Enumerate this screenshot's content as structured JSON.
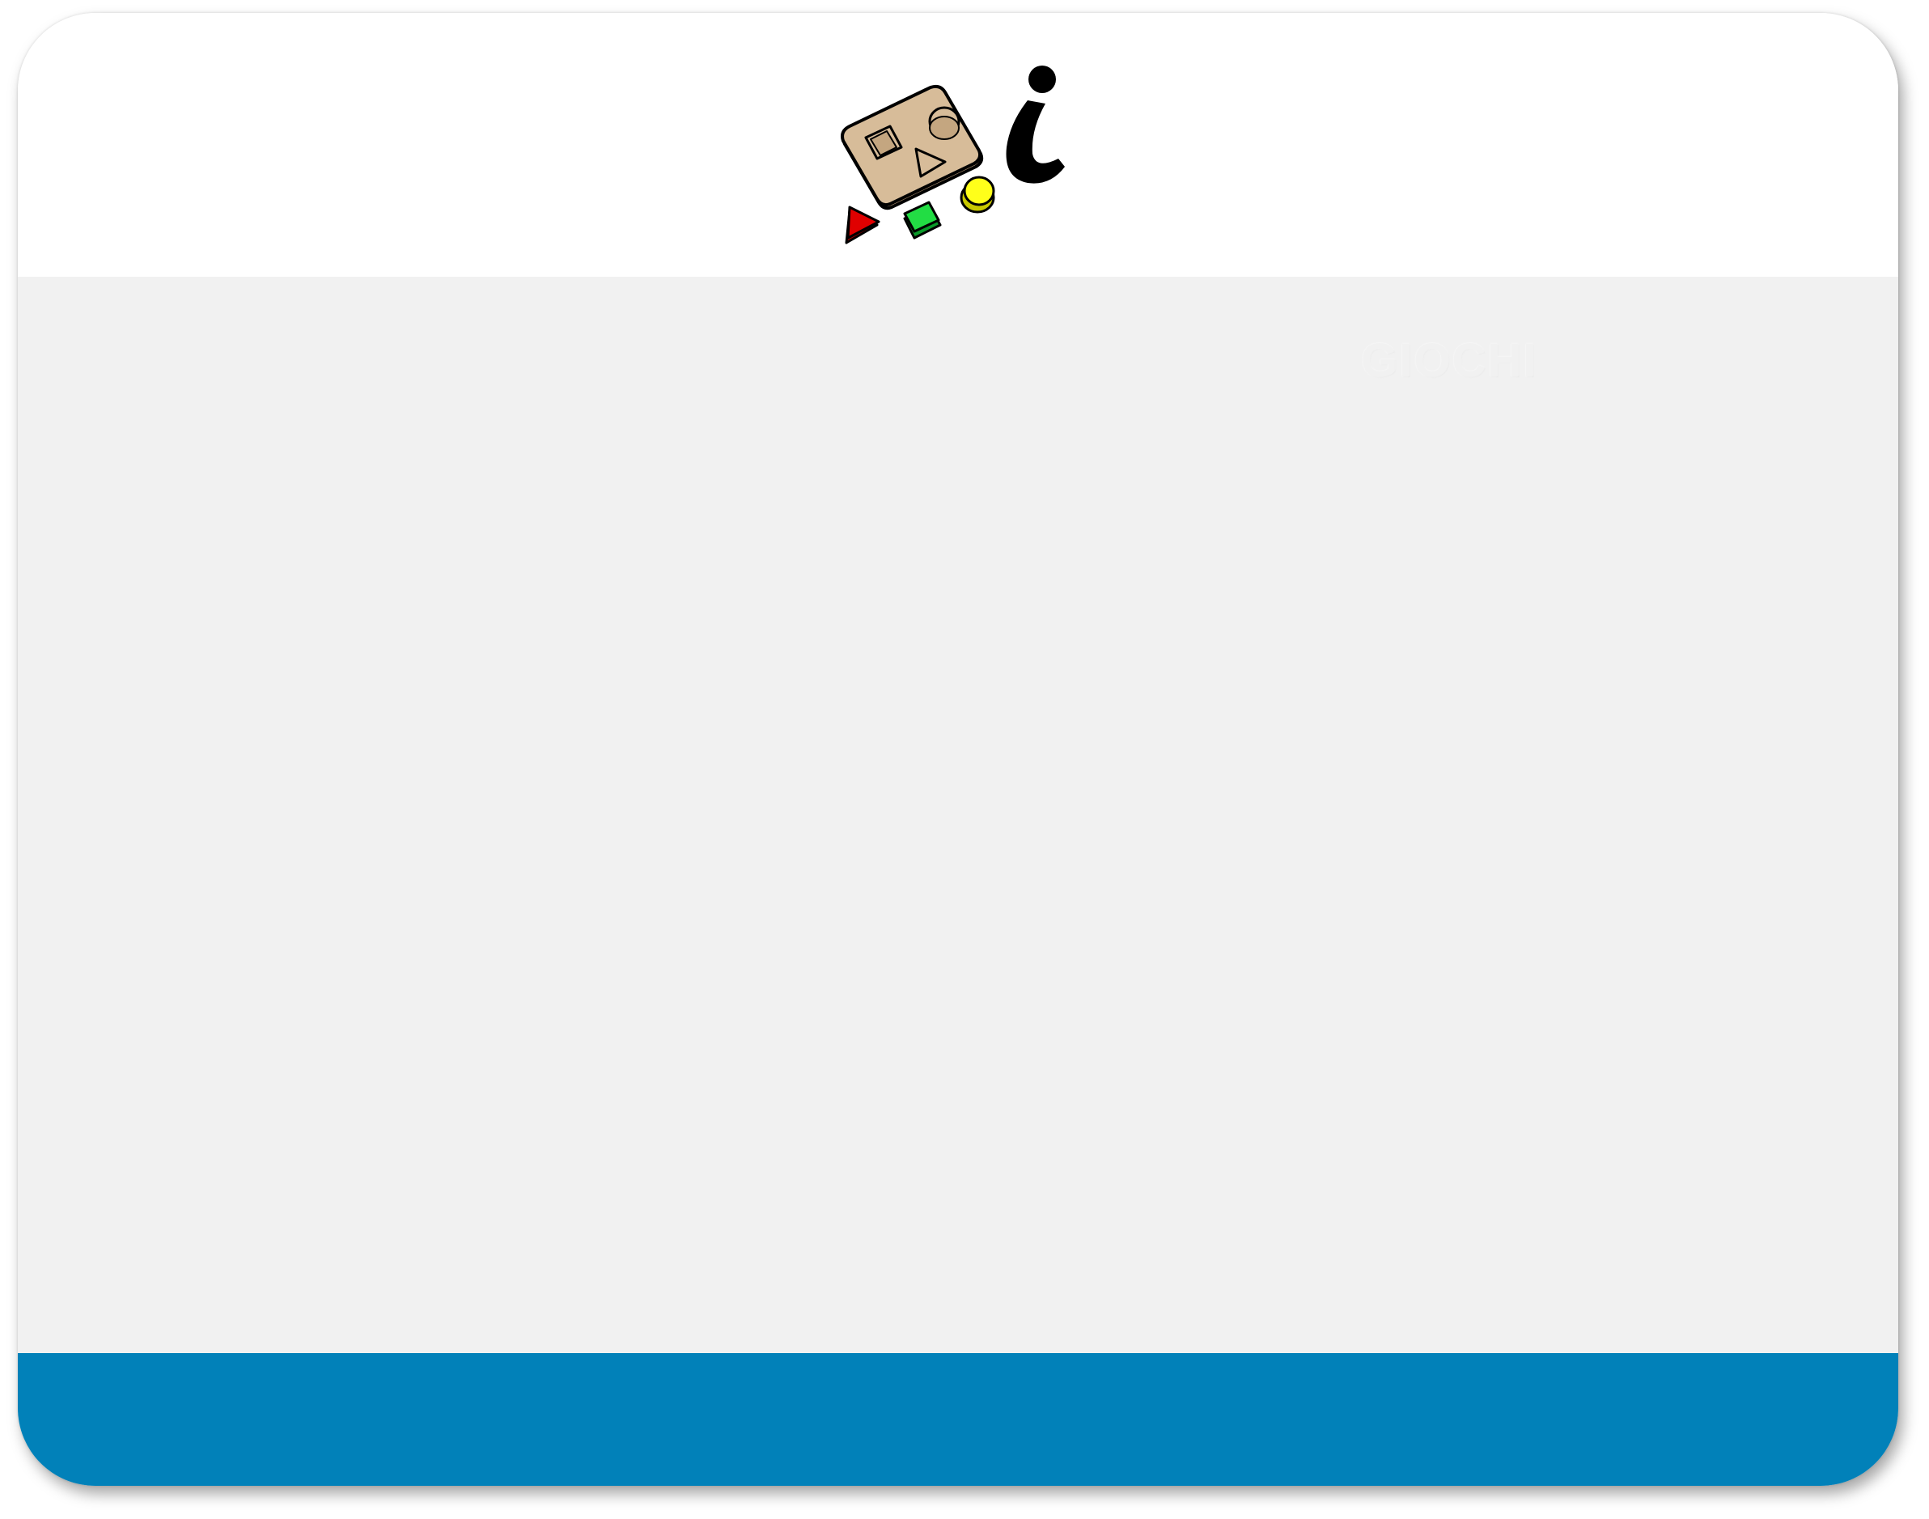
{
  "card": {
    "label": "GIOCHI",
    "header_icon": "shape-sorter-info-icon"
  },
  "colors": {
    "header": "#ffffff",
    "content": "#f1f1f1",
    "footer": "#0181b9"
  }
}
